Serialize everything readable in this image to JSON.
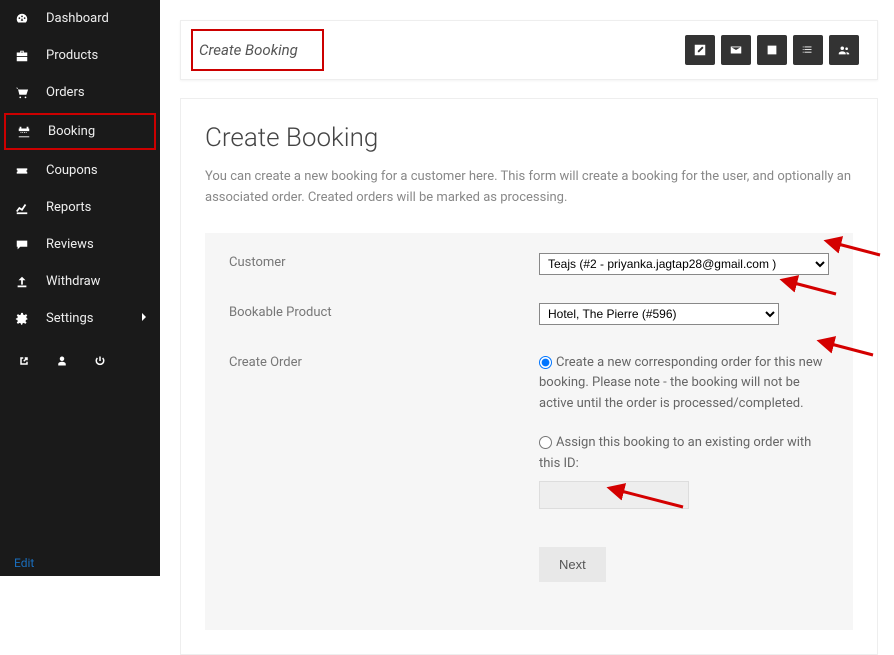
{
  "sidebar": {
    "items": [
      {
        "icon": "tachometer",
        "label": "Dashboard"
      },
      {
        "icon": "briefcase",
        "label": "Products"
      },
      {
        "icon": "cart",
        "label": "Orders"
      },
      {
        "icon": "calendar",
        "label": "Booking"
      },
      {
        "icon": "ticket",
        "label": "Coupons"
      },
      {
        "icon": "chart",
        "label": "Reports"
      },
      {
        "icon": "comment",
        "label": "Reviews"
      },
      {
        "icon": "upload",
        "label": "Withdraw"
      },
      {
        "icon": "gear",
        "label": "Settings"
      }
    ]
  },
  "topbar": {
    "title": "Create Booking"
  },
  "page": {
    "title": "Create Booking",
    "description": "You can create a new booking for a customer here. This form will create a booking for the user, and optionally an associated order. Created orders will be marked as processing."
  },
  "form": {
    "customer_label": "Customer",
    "customer_value": "Teajs (#2 - priyanka.jagtap28@gmail.com )",
    "product_label": "Bookable Product",
    "product_value": "Hotel, The Pierre (#596)",
    "create_order_label": "Create Order",
    "radio1_label": "Create a new corresponding order for this new booking. Please note - the booking will not be active until the order is processed/completed.",
    "radio2_label": "Assign this booking to an existing order with this ID:",
    "next_label": "Next"
  },
  "edit_link": "Edit"
}
